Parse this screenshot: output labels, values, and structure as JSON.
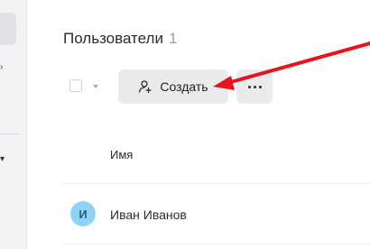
{
  "page": {
    "title": "Пользователи",
    "count": "1"
  },
  "toolbar": {
    "create_label": "Создать",
    "create_icon": "add-user-icon",
    "more_icon": "more-icon"
  },
  "table": {
    "columns": [
      "Имя"
    ],
    "rows": [
      {
        "avatar_letter": "И",
        "name": "Иван Иванов"
      }
    ]
  },
  "colors": {
    "annotation_arrow": "#e8141c",
    "avatar_bg": "#8fd3f4",
    "button_bg": "#ebebee"
  }
}
